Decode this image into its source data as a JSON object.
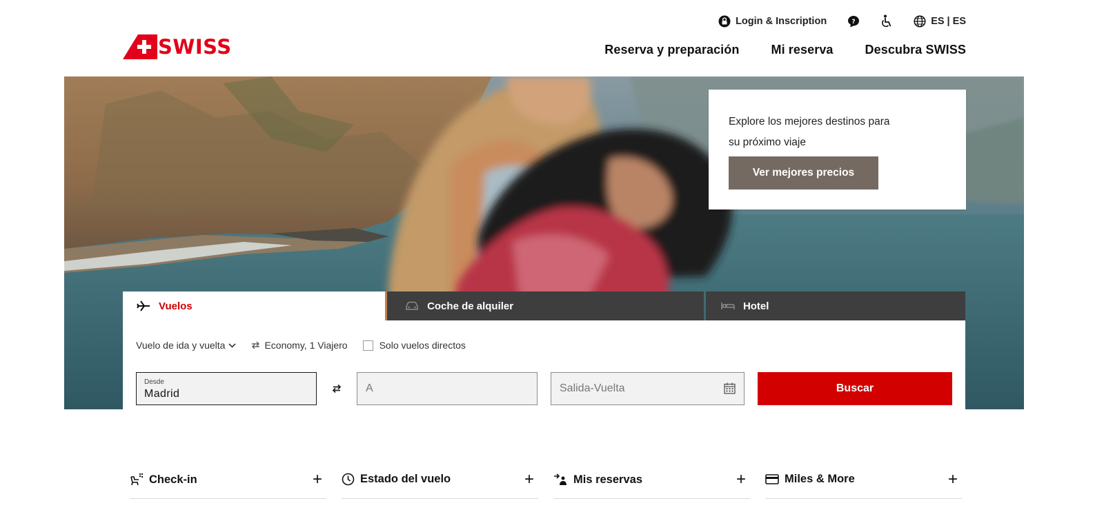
{
  "brand": {
    "name": "SWISS",
    "color": "#e2001a"
  },
  "utility_nav": {
    "login_label": "Login & Inscription",
    "language_label": "ES | ES",
    "icons": [
      "user-lock-icon",
      "chat-help-icon",
      "accessibility-icon",
      "globe-icon"
    ]
  },
  "main_nav": {
    "items": [
      {
        "label": "Reserva y preparación"
      },
      {
        "label": "Mi reserva"
      },
      {
        "label": "Descubra SWISS"
      }
    ]
  },
  "promo": {
    "text": "Explore los mejores destinos para su próximo viaje",
    "button_label": "Ver mejores precios",
    "button_color": "#756a62"
  },
  "booking": {
    "tabs": [
      {
        "label": "Vuelos",
        "icon": "plane-icon",
        "active": true
      },
      {
        "label": "Coche de alquiler",
        "icon": "car-icon",
        "active": false
      },
      {
        "label": "Hotel",
        "icon": "bed-icon",
        "active": false
      }
    ],
    "trip_type": "Vuelo de ida y vuelta",
    "cabin_travellers": "Economy, 1 Viajero",
    "direct_only_label": "Solo vuelos directos",
    "direct_only_checked": false,
    "from": {
      "label": "Desde",
      "value": "Madrid"
    },
    "to": {
      "placeholder": "A"
    },
    "dates": {
      "placeholder": "Salida-Vuelta"
    },
    "search_label": "Buscar",
    "search_color": "#d30000"
  },
  "quick_links": [
    {
      "label": "Check-in",
      "icon": "checkin-icon"
    },
    {
      "label": "Estado del vuelo",
      "icon": "clock-icon"
    },
    {
      "label": "Mis reservas",
      "icon": "booking-person-icon"
    },
    {
      "label": "Miles & More",
      "icon": "card-icon"
    }
  ]
}
